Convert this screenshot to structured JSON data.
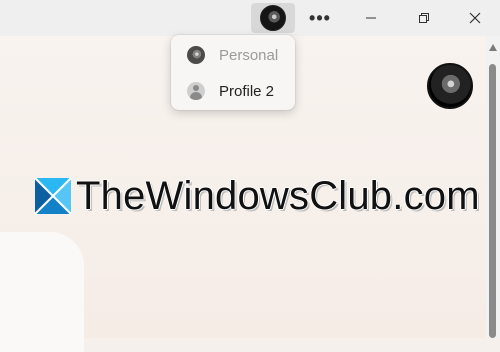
{
  "titlebar": {
    "more_label": "•••",
    "icons": {
      "profile": "profile-avatar-icon",
      "minimize": "minimize-icon",
      "restore": "restore-icon",
      "close": "close-icon"
    }
  },
  "profile_menu": {
    "items": [
      {
        "label": "Personal",
        "icon": "personal-avatar-icon",
        "state": "current"
      },
      {
        "label": "Profile 2",
        "icon": "generic-person-icon",
        "state": "available"
      }
    ]
  },
  "watermark": {
    "text": "TheWindowsClub.com",
    "colors": {
      "blue": "#1aa3e8",
      "dark_blue": "#0d5f9f",
      "text": "#111111"
    }
  },
  "content": {
    "avatar_icon": "profile-avatar-large-icon"
  }
}
